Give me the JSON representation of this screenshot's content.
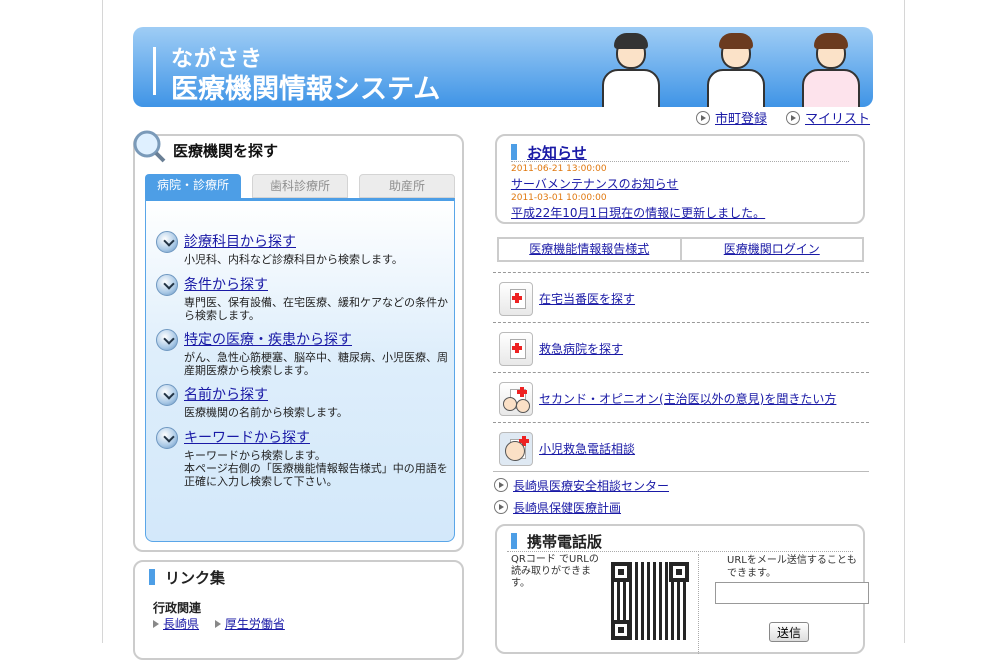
{
  "banner": {
    "line1": "ながさき",
    "line2": "医療機関情報システム"
  },
  "header_links": {
    "shichou": "市町登録",
    "mylist": "マイリスト"
  },
  "search": {
    "title": "医療機関を探す",
    "tabs": [
      "病院・診療所",
      "歯科診療所",
      "助産所"
    ],
    "items": [
      {
        "label": "診療科目から探す",
        "desc": "小児科、内科など診療科目から検索します。"
      },
      {
        "label": "条件から探す",
        "desc": "専門医、保有設備、在宅医療、緩和ケアなどの条件から検索します。"
      },
      {
        "label": "特定の医療・疾患から探す",
        "desc": "がん、急性心筋梗塞、脳卒中、糖尿病、小児医療、周産期医療から検索します。"
      },
      {
        "label": "名前から探す",
        "desc": "医療機関の名前から検索します。"
      },
      {
        "label": "キーワードから探す",
        "desc": "キーワードから検索します。\n本ページ右側の「医療機能情報報告様式」中の用語を正確に入力し検索して下さい。"
      }
    ]
  },
  "notice": {
    "title": "お知らせ",
    "entries": [
      {
        "date": "2011-06-21 13:00:00",
        "text": "サーバメンテナンスのお知らせ"
      },
      {
        "date": "2011-03-01 10:00:00",
        "text": "平成22年10月1日現在の情報に更新しました。"
      }
    ]
  },
  "buttons": {
    "report": "医療機能情報報告様式",
    "login": "医療機関ログイン"
  },
  "list": [
    {
      "label": "在宅当番医を探す",
      "icon": "clinic-sign-icon"
    },
    {
      "label": "救急病院を探す",
      "icon": "clinic-sign-icon"
    },
    {
      "label": "セカンド・オピニオン(主治医以外の意見)を聞きたい方",
      "icon": "doctors-consult-icon"
    },
    {
      "label": "小児救急電話相談",
      "icon": "nurse-phone-icon"
    }
  ],
  "plain_links": [
    "長崎県医療安全相談センター",
    "長崎県保健医療計画"
  ],
  "mobile": {
    "title": "携帯電話版",
    "qr_text": "QRコード でURLの読み取りができます。",
    "mail_text": "URLをメール送信することもできます。",
    "input_value": "",
    "send_label": "送信"
  },
  "links": {
    "title": "リンク集",
    "sub": "行政関連",
    "items": [
      "長崎県",
      "厚生労働省"
    ]
  },
  "colors": {
    "accent": "#4d9ee6",
    "link": "#1a1aa6",
    "date": "#e0780f"
  }
}
